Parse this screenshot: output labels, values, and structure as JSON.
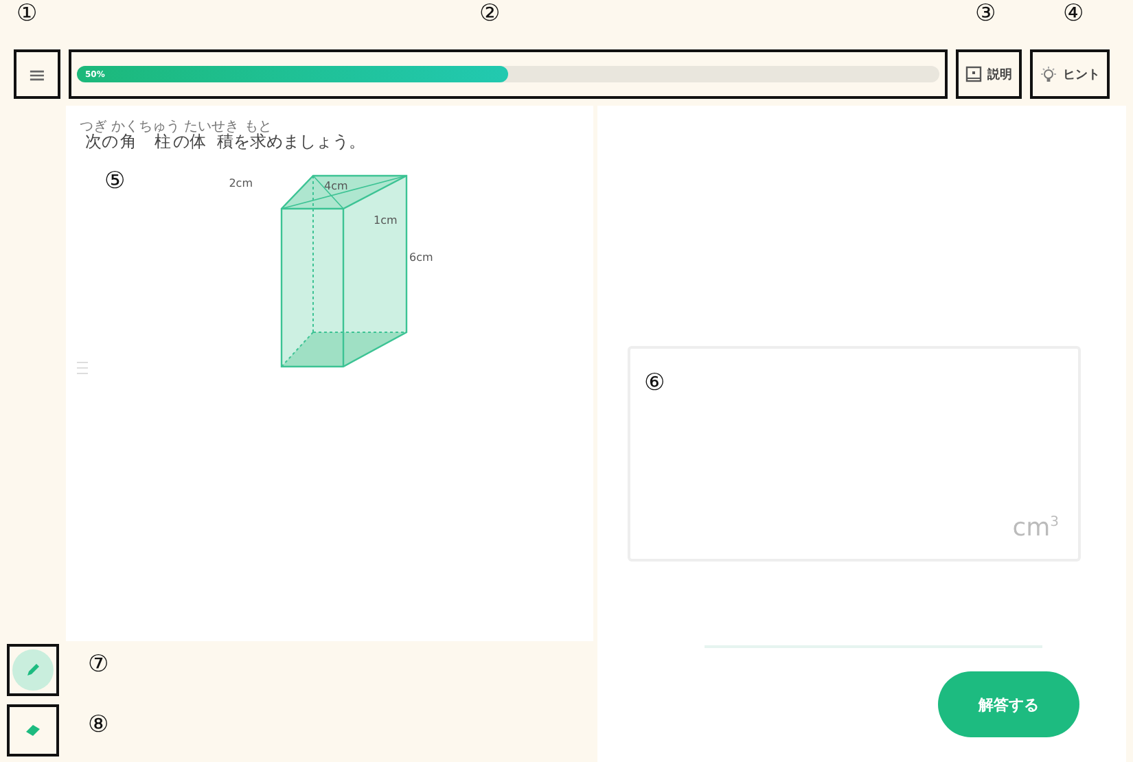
{
  "callouts": [
    "①",
    "②",
    "③",
    "④",
    "⑤",
    "⑥",
    "⑦",
    "⑧"
  ],
  "toolbar": {
    "menu_icon": "≡",
    "progress": {
      "level": 0.5,
      "label": "50%"
    },
    "buttons": [
      {
        "kind": "explain",
        "label": "説明"
      },
      {
        "kind": "hint",
        "label": "ヒント"
      }
    ]
  },
  "question": {
    "segments": [
      {
        "text": "次",
        "ruby": "つぎ"
      },
      {
        "text": "の"
      },
      {
        "text": "角柱",
        "ruby": "かくちゅう"
      },
      {
        "text": "の"
      },
      {
        "text": "体積",
        "ruby": "たいせき"
      },
      {
        "text": "を"
      },
      {
        "text": "求",
        "ruby": "もと"
      },
      {
        "text": "めましょう。"
      }
    ],
    "diagram_labels": [
      "2cm",
      "4cm",
      "1cm",
      "6cm"
    ]
  },
  "answer": {
    "unit": "cm$^{3}$",
    "submit": "解答する"
  },
  "tools": [
    {
      "kind": "pen",
      "selected": true
    },
    {
      "kind": "eraser",
      "selected": false
    }
  ]
}
